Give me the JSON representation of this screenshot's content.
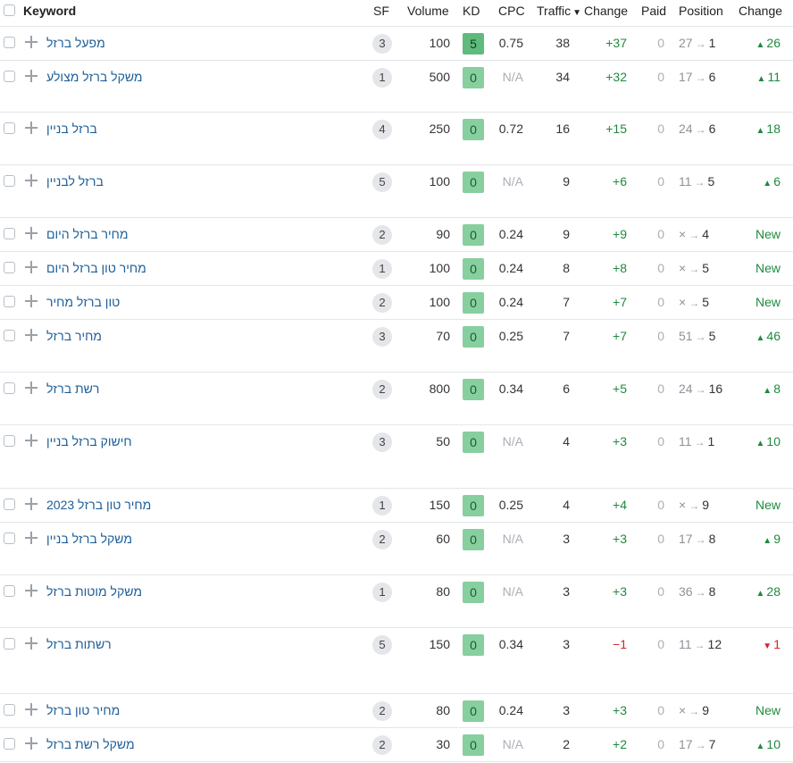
{
  "header": {
    "keyword": "Keyword",
    "sf": "SF",
    "volume": "Volume",
    "kd": "KD",
    "cpc": "CPC",
    "traffic": "Traffic",
    "sort_icon": "caret-down-icon",
    "change": "Change",
    "paid": "Paid",
    "position": "Position",
    "position_change": "Change"
  },
  "colors": {
    "link": "#1c5d99",
    "positive": "#1e8a3f",
    "negative": "#d2242a",
    "kd_badge": "#87cf9f"
  },
  "rows": [
    {
      "keyword": "מפעל ברזל",
      "sf": "3",
      "volume": "100",
      "kd": "5",
      "cpc": "0.75",
      "traffic": "38",
      "change": "+37",
      "paid": "0",
      "pos_from": "27",
      "pos_to": "1",
      "pos_change": "26",
      "pos_dir": "up"
    },
    {
      "keyword": "משקל ברזל מצולע",
      "sf": "1",
      "volume": "500",
      "kd": "0",
      "cpc": "N/A",
      "traffic": "34",
      "change": "+32",
      "paid": "0",
      "pos_from": "17",
      "pos_to": "6",
      "pos_change": "11",
      "pos_dir": "up"
    },
    {
      "keyword": "ברזל בניין",
      "sf": "4",
      "volume": "250",
      "kd": "0",
      "cpc": "0.72",
      "traffic": "16",
      "change": "+15",
      "paid": "0",
      "pos_from": "24",
      "pos_to": "6",
      "pos_change": "18",
      "pos_dir": "up"
    },
    {
      "keyword": "ברזל לבניין",
      "sf": "5",
      "volume": "100",
      "kd": "0",
      "cpc": "N/A",
      "traffic": "9",
      "change": "+6",
      "paid": "0",
      "pos_from": "11",
      "pos_to": "5",
      "pos_change": "6",
      "pos_dir": "up"
    },
    {
      "keyword": "מחיר ברזל היום",
      "sf": "2",
      "volume": "90",
      "kd": "0",
      "cpc": "0.24",
      "traffic": "9",
      "change": "+9",
      "paid": "0",
      "pos_from": "×",
      "pos_to": "4",
      "pos_change": "New",
      "pos_dir": "new"
    },
    {
      "keyword": "מחיר טון ברזל היום",
      "sf": "1",
      "volume": "100",
      "kd": "0",
      "cpc": "0.24",
      "traffic": "8",
      "change": "+8",
      "paid": "0",
      "pos_from": "×",
      "pos_to": "5",
      "pos_change": "New",
      "pos_dir": "new"
    },
    {
      "keyword": "טון ברזל מחיר",
      "sf": "2",
      "volume": "100",
      "kd": "0",
      "cpc": "0.24",
      "traffic": "7",
      "change": "+7",
      "paid": "0",
      "pos_from": "×",
      "pos_to": "5",
      "pos_change": "New",
      "pos_dir": "new"
    },
    {
      "keyword": "מחיר ברזל",
      "sf": "3",
      "volume": "70",
      "kd": "0",
      "cpc": "0.25",
      "traffic": "7",
      "change": "+7",
      "paid": "0",
      "pos_from": "51",
      "pos_to": "5",
      "pos_change": "46",
      "pos_dir": "up"
    },
    {
      "keyword": "רשת ברזל",
      "sf": "2",
      "volume": "800",
      "kd": "0",
      "cpc": "0.34",
      "traffic": "6",
      "change": "+5",
      "paid": "0",
      "pos_from": "24",
      "pos_to": "16",
      "pos_change": "8",
      "pos_dir": "up"
    },
    {
      "keyword": "חישוק ברזל בניין",
      "sf": "3",
      "volume": "50",
      "kd": "0",
      "cpc": "N/A",
      "traffic": "4",
      "change": "+3",
      "paid": "0",
      "pos_from": "11",
      "pos_to": "1",
      "pos_change": "10",
      "pos_dir": "up"
    },
    {
      "keyword": "מחיר טון ברזל 2023",
      "sf": "1",
      "volume": "150",
      "kd": "0",
      "cpc": "0.25",
      "traffic": "4",
      "change": "+4",
      "paid": "0",
      "pos_from": "×",
      "pos_to": "9",
      "pos_change": "New",
      "pos_dir": "new"
    },
    {
      "keyword": "משקל ברזל בניין",
      "sf": "2",
      "volume": "60",
      "kd": "0",
      "cpc": "N/A",
      "traffic": "3",
      "change": "+3",
      "paid": "0",
      "pos_from": "17",
      "pos_to": "8",
      "pos_change": "9",
      "pos_dir": "up"
    },
    {
      "keyword": "משקל מוטות ברזל",
      "sf": "1",
      "volume": "80",
      "kd": "0",
      "cpc": "N/A",
      "traffic": "3",
      "change": "+3",
      "paid": "0",
      "pos_from": "36",
      "pos_to": "8",
      "pos_change": "28",
      "pos_dir": "up"
    },
    {
      "keyword": "רשתות ברזל",
      "sf": "5",
      "volume": "150",
      "kd": "0",
      "cpc": "0.34",
      "traffic": "3",
      "change": "−1",
      "paid": "0",
      "pos_from": "11",
      "pos_to": "12",
      "pos_change": "1",
      "pos_dir": "down"
    },
    {
      "keyword": "מחיר טון ברזל",
      "sf": "2",
      "volume": "80",
      "kd": "0",
      "cpc": "0.24",
      "traffic": "3",
      "change": "+3",
      "paid": "0",
      "pos_from": "×",
      "pos_to": "9",
      "pos_change": "New",
      "pos_dir": "new"
    },
    {
      "keyword": "משקל רשת ברזל",
      "sf": "2",
      "volume": "30",
      "kd": "0",
      "cpc": "N/A",
      "traffic": "2",
      "change": "+2",
      "paid": "0",
      "pos_from": "17",
      "pos_to": "7",
      "pos_change": "10",
      "pos_dir": "up"
    }
  ]
}
